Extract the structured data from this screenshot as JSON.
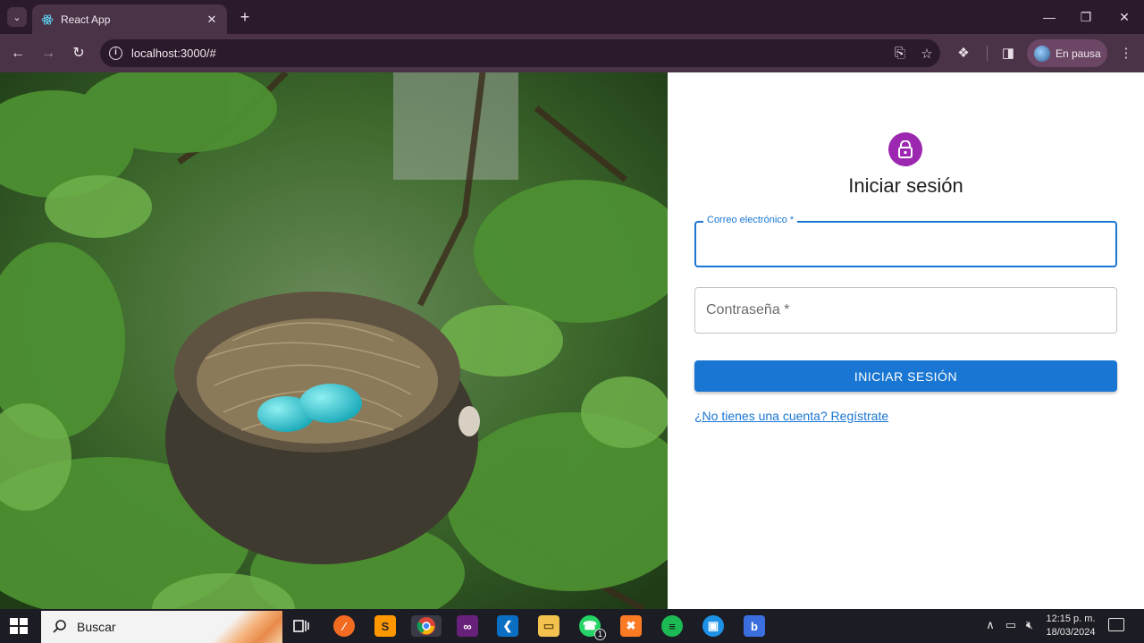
{
  "browser": {
    "tab_title": "React App",
    "url": "localhost:3000/#",
    "profile_label": "En pausa"
  },
  "login": {
    "heading": "Iniciar sesión",
    "email_label": "Correo electrónico *",
    "password_label": "Contraseña *",
    "submit_label": "INICIAR SESIÓN",
    "signup_link": "¿No tienes una cuenta? Regístrate"
  },
  "colors": {
    "primary": "#1976d2",
    "avatar": "#9c27b0",
    "chrome_frame": "#2b1a2b",
    "chrome_toolbar": "#4a3347"
  },
  "taskbar": {
    "search_label": "Buscar",
    "apps": [
      "task-view",
      "brave",
      "sublime-text",
      "chrome",
      "visual-studio",
      "vscode",
      "file-explorer",
      "whatsapp",
      "xampp",
      "spotify",
      "docker",
      "bing"
    ],
    "whatsapp_badge": "1",
    "time": "12:15 p. m.",
    "date": "18/03/2024"
  }
}
